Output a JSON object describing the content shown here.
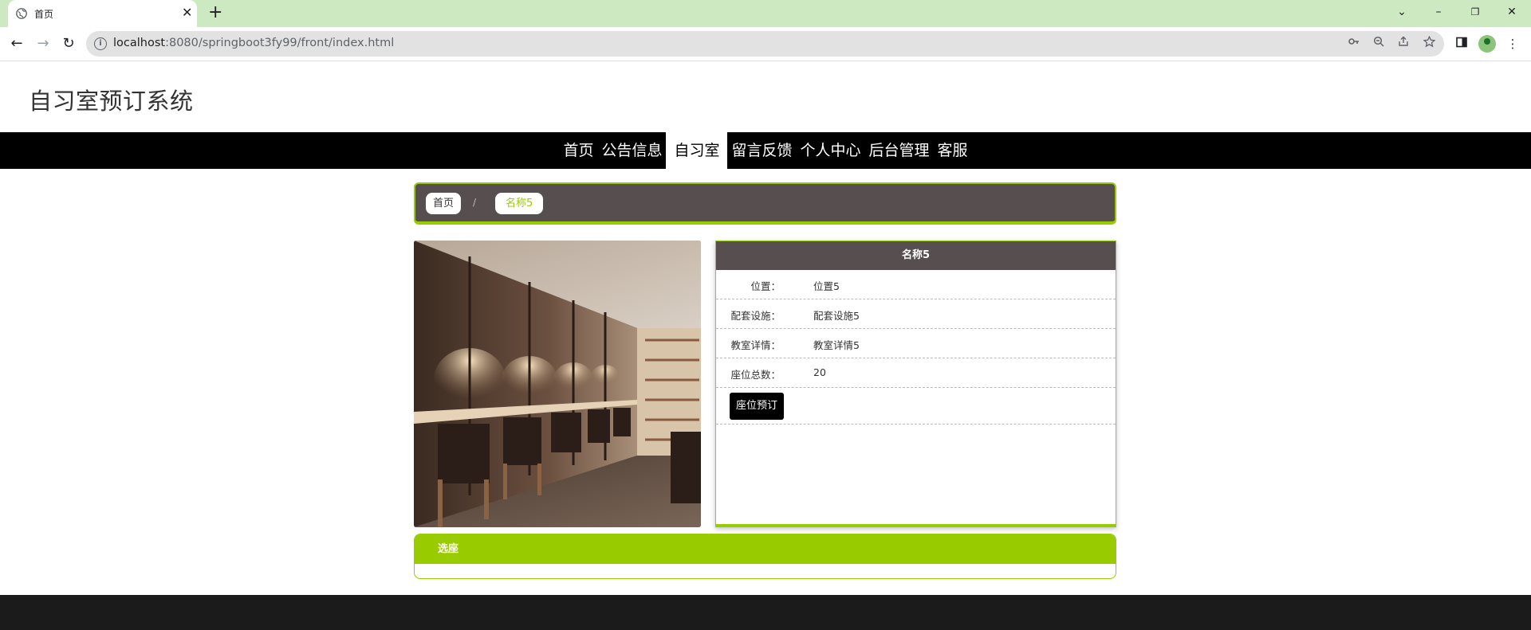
{
  "browser": {
    "tab_title": "首页",
    "tab_close": "✕",
    "new_tab": "+",
    "url_host": "localhost",
    "url_rest": ":8080/springboot3fy99/front/index.html",
    "window_controls": {
      "tab_search": "⌄",
      "minimize": "–",
      "restore": "❐",
      "close": "✕"
    },
    "nav": {
      "back": "←",
      "forward": "→",
      "reload": "↻"
    },
    "icons": [
      "key-icon",
      "zoom-icon",
      "share-icon",
      "star-icon",
      "sidepanel-icon",
      "profile-icon",
      "menu-icon"
    ],
    "menu_glyph": "⋮"
  },
  "site": {
    "title": "自习室预订系统",
    "nav": [
      "首页",
      "公告信息",
      "自习室",
      "留言反馈",
      "个人中心",
      "后台管理",
      "客服"
    ],
    "active_nav": "自习室"
  },
  "breadcrumb": {
    "home": "首页",
    "separator": "/",
    "current": "名称5"
  },
  "detail": {
    "name": "名称5",
    "fields": [
      {
        "label": "位置：",
        "value": "位置5"
      },
      {
        "label": "配套设施：",
        "value": "配套设施5"
      },
      {
        "label": "教室详情：",
        "value": "教室详情5"
      },
      {
        "label": "座位总数：",
        "value": "20"
      }
    ],
    "book_button": "座位预订"
  },
  "comments": {
    "title": "选座"
  },
  "colors": {
    "accent": "#99cc00",
    "dark_panel": "#574f4f",
    "nav_bg": "#000000",
    "footer": "#1b1b1b",
    "tabbar": "#cde9c1"
  }
}
